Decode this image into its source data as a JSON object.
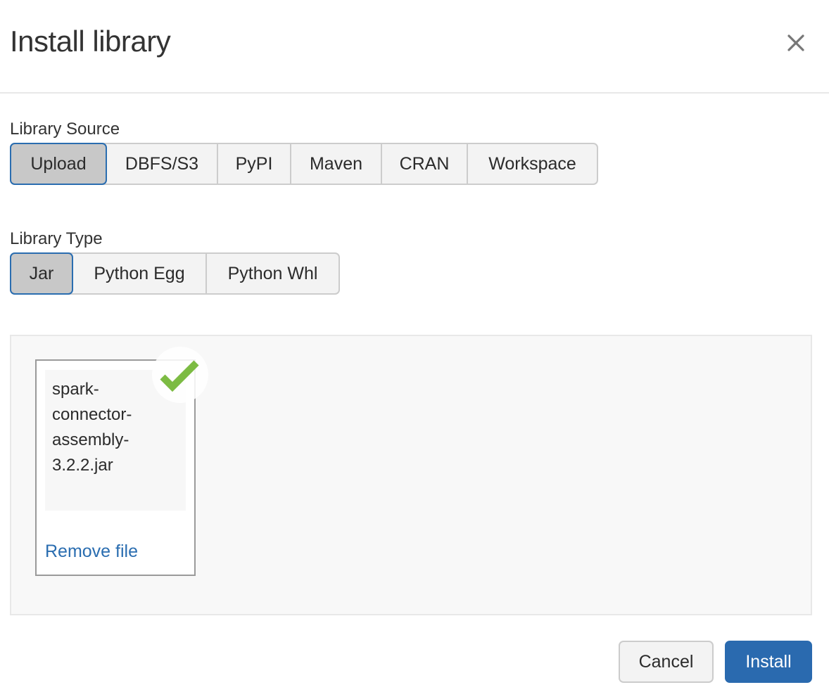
{
  "dialog": {
    "title": "Install library",
    "close_icon": "close-icon"
  },
  "library_source": {
    "label": "Library Source",
    "options": [
      {
        "label": "Upload",
        "selected": true
      },
      {
        "label": "DBFS/S3",
        "selected": false
      },
      {
        "label": "PyPI",
        "selected": false
      },
      {
        "label": "Maven",
        "selected": false
      },
      {
        "label": "CRAN",
        "selected": false
      },
      {
        "label": "Workspace",
        "selected": false
      }
    ]
  },
  "library_type": {
    "label": "Library Type",
    "options": [
      {
        "label": "Jar",
        "selected": true
      },
      {
        "label": "Python Egg",
        "selected": false
      },
      {
        "label": "Python Whl",
        "selected": false
      }
    ]
  },
  "upload": {
    "file": {
      "name": "spark-connector-assembly-3.2.2.jar",
      "status_icon": "checkmark-icon",
      "status": "uploaded",
      "remove_label": "Remove file"
    }
  },
  "footer": {
    "cancel_label": "Cancel",
    "install_label": "Install"
  },
  "colors": {
    "accent": "#2a6aaf",
    "success": "#7cbb43",
    "link": "#2a6db0"
  }
}
